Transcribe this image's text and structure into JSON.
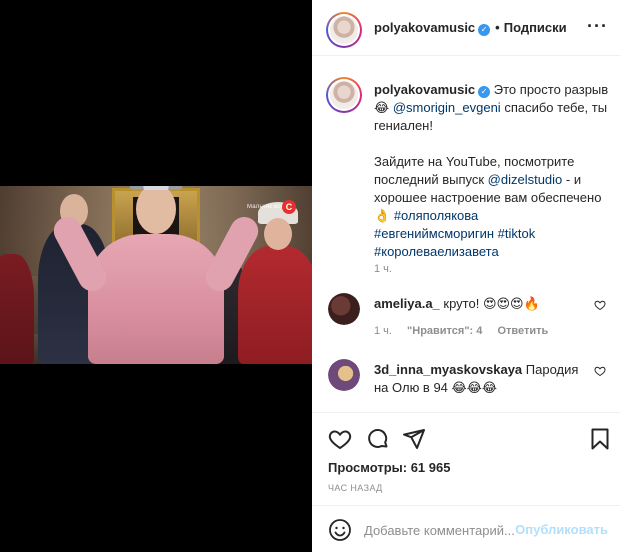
{
  "header": {
    "username": "polyakovamusic",
    "follow_label": "Подписки",
    "dot": "•"
  },
  "media": {
    "watermark_text": "Мальчик все",
    "channel_logo": "С"
  },
  "caption": {
    "username": "polyakovamusic",
    "line1_text": "Это просто разрыв 😂",
    "mention1": "@smorigin_evgeni",
    "line1_end": "спасибо тебе, ты гениален!",
    "para2_text": "Зайдите на YouTube, посмотрите последний выпуск",
    "mention2": "@dizelstudio",
    "para2_end": "- и хорошее настроение вам обеспечено 👌",
    "hashtags": [
      "#оляполякова",
      "#евгениймсморигин",
      "#tiktok",
      "#королеваелизавета"
    ],
    "time": "1 ч."
  },
  "comments": [
    {
      "username": "ameliya.a_",
      "text": "круто! 😍😍😍🔥",
      "time": "1 ч.",
      "likes": "\"Нравится\": 4",
      "reply": "Ответить"
    },
    {
      "username": "3d_inna_myaskovskaya",
      "text": "Пародия на Олю в 94 😂😂😂"
    }
  ],
  "footer": {
    "views_label": "Просмотры: 61 965",
    "time_ago": "ЧАС НАЗАД",
    "comment_placeholder": "Добавьте комментарий...",
    "publish_label": "Опубликовать"
  },
  "icons": {
    "more": "more-horizontal-icon",
    "like": "heart-icon",
    "comment": "comment-icon",
    "share": "paper-plane-icon",
    "save": "bookmark-icon",
    "emoji": "smile-icon"
  },
  "colors": {
    "link": "#00376b",
    "verified": "#3897f0",
    "muted": "#8e8e8e",
    "publish_disabled": "#b2dffc"
  }
}
